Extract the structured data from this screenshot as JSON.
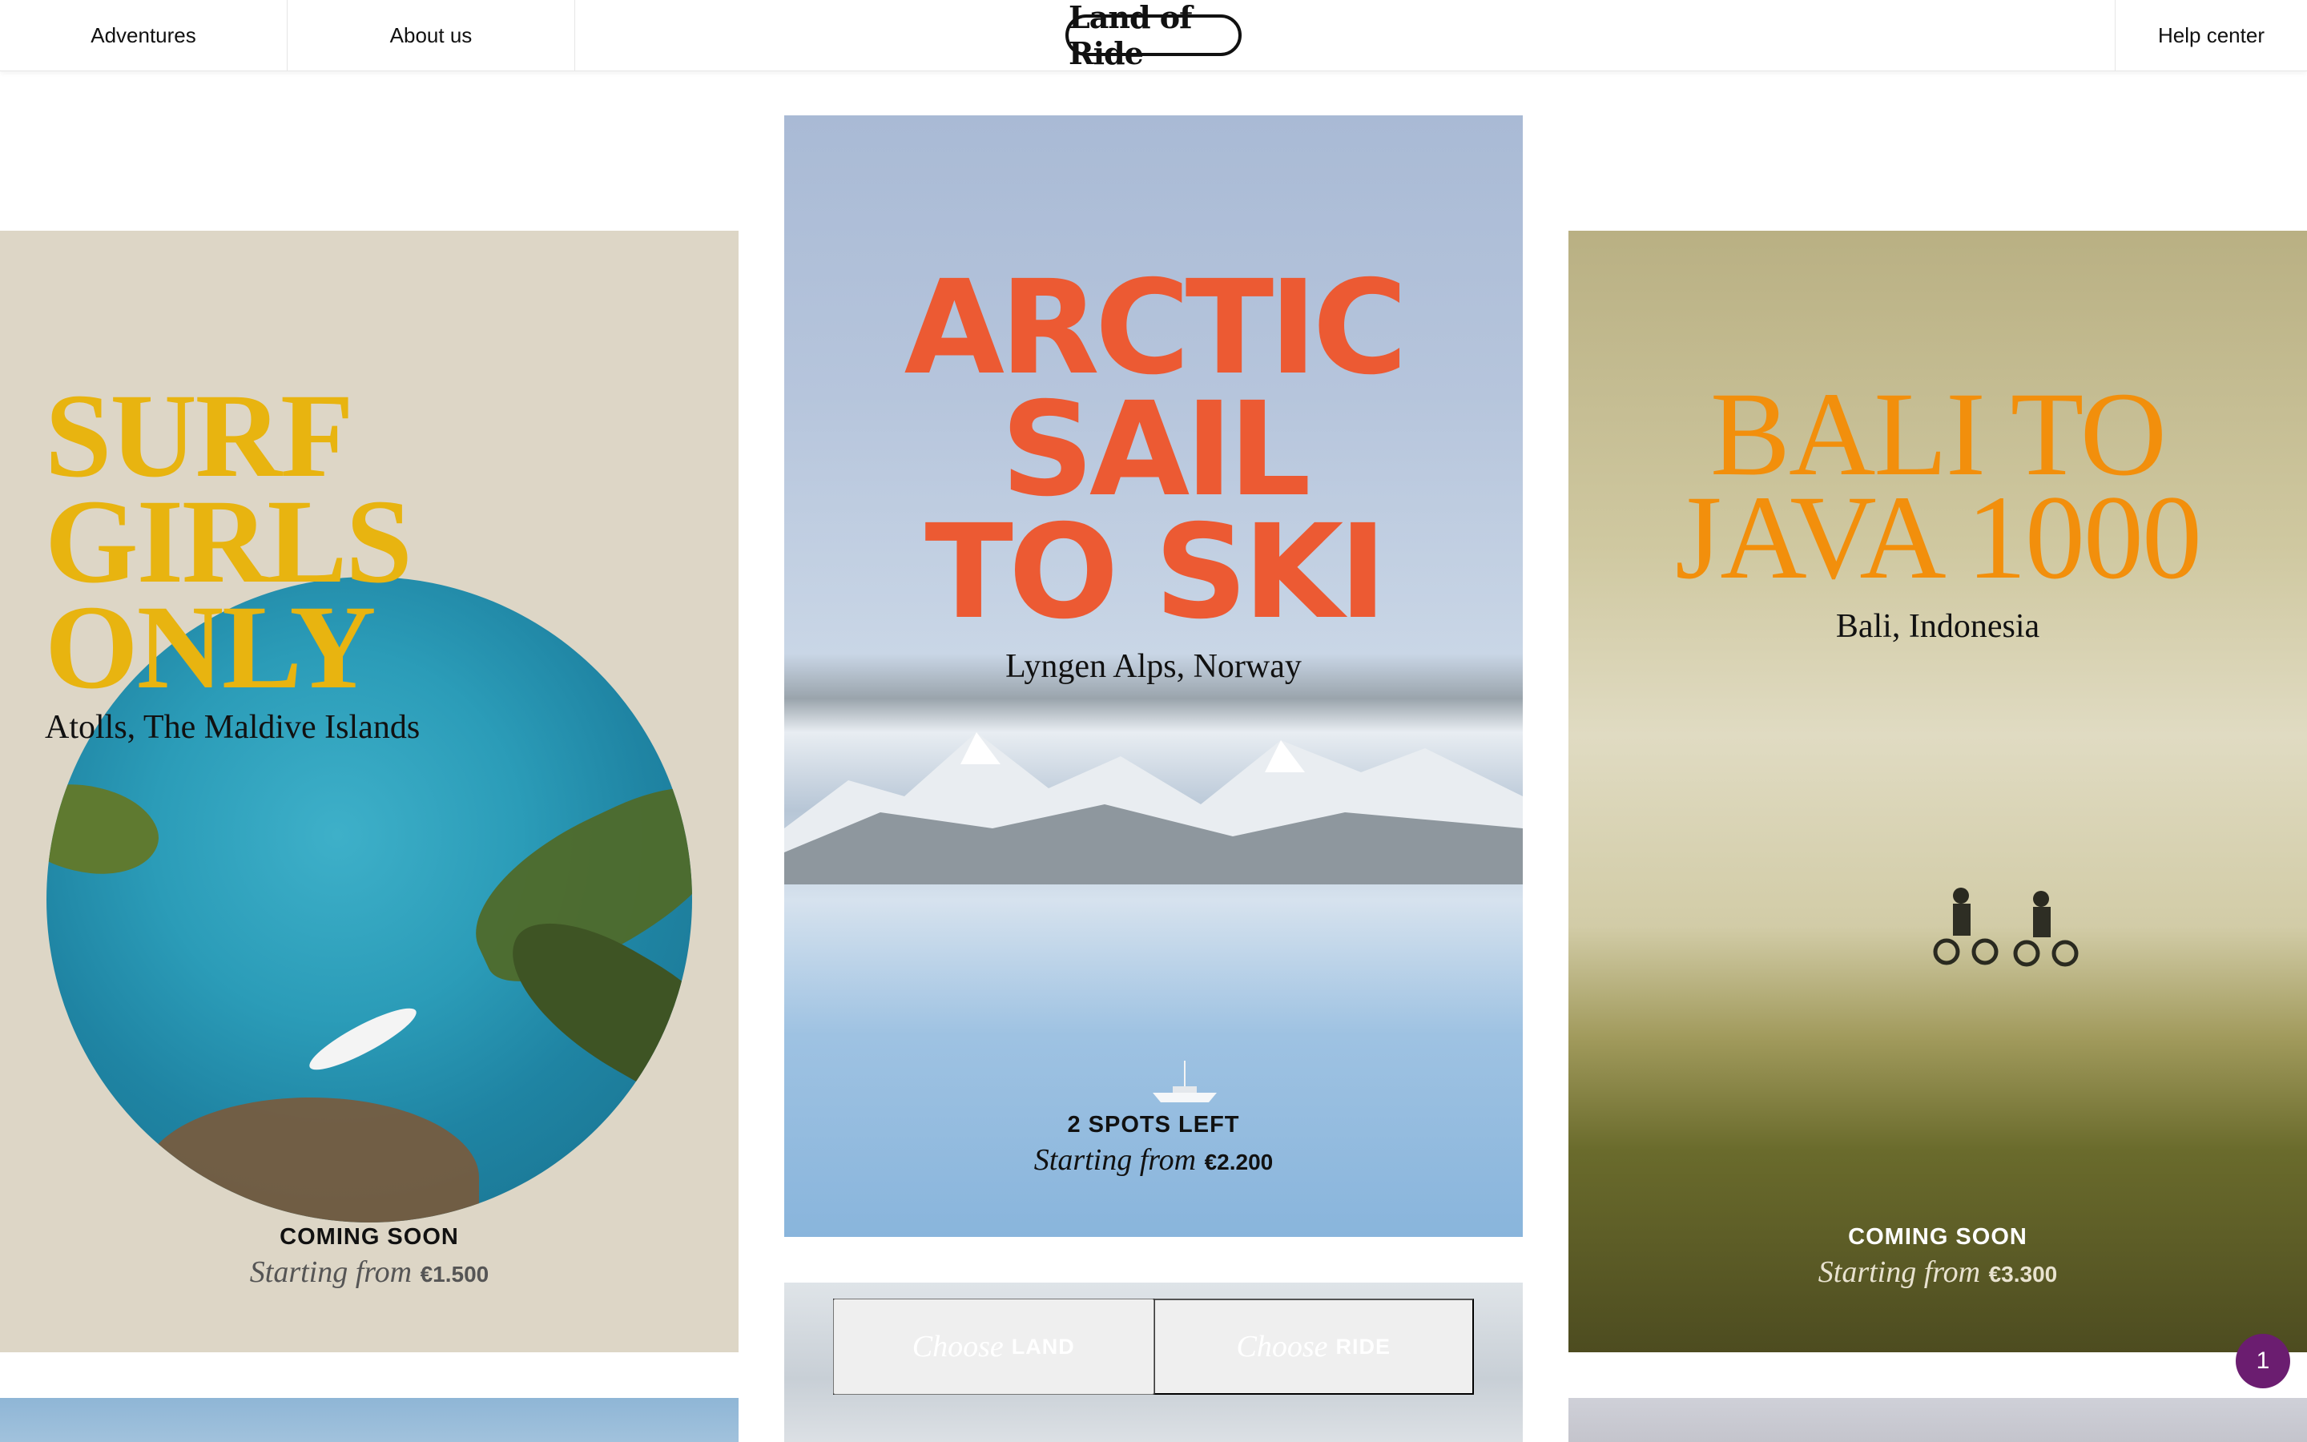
{
  "nav": {
    "adventures": "Adventures",
    "about": "About us",
    "logo": "Land of Ride",
    "help": "Help center"
  },
  "cards": {
    "surf": {
      "title_lines": [
        "SURF",
        "GIRLS",
        "ONLY"
      ],
      "location": "Atolls, The Maldive Islands",
      "status": "COMING SOON",
      "price_prefix": "Starting from",
      "price": "€1.500",
      "title_color": "#e8b410"
    },
    "arctic": {
      "title_lines": [
        "ARCTIC",
        "SAIL",
        "TO SKI"
      ],
      "location": "Lyngen Alps, Norway",
      "status": "2 SPOTS LEFT",
      "price_prefix": "Starting from",
      "price": "€2.200",
      "title_color": "#ec5a33"
    },
    "bali": {
      "title_lines": [
        "BALI TO",
        "JAVA 1000"
      ],
      "location": "Bali, Indonesia",
      "status": "COMING SOON",
      "price_prefix": "Starting from",
      "price": "€3.300",
      "title_color": "#f28f0c"
    }
  },
  "choose": {
    "land_prefix": "Choose",
    "land_word": "LAND",
    "ride_prefix": "Choose",
    "ride_word": "RIDE"
  },
  "notification": {
    "count": "1"
  }
}
